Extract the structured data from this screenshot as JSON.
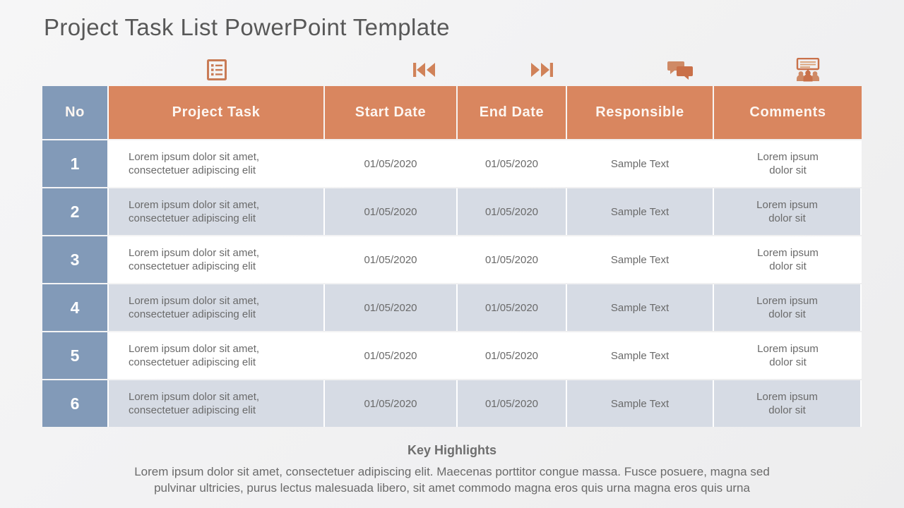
{
  "slide": {
    "title": "Project Task List PowerPoint Template",
    "background_color": "#f3f3f4",
    "accent_color": "#d9865f",
    "secondary_color": "#829ab8",
    "alt_row_color": "#d6dbe4"
  },
  "icons": [
    {
      "name": "checklist-icon",
      "label": "checklist"
    },
    {
      "name": "skip-start-icon",
      "label": "skip-to-start"
    },
    {
      "name": "skip-end-icon",
      "label": "skip-to-end"
    },
    {
      "name": "comments-icon",
      "label": "speech-bubbles"
    },
    {
      "name": "presentation-team-icon",
      "label": "presentation-with-audience"
    }
  ],
  "table": {
    "headers": {
      "no": "No",
      "task": "Project Task",
      "start_date": "Start Date",
      "end_date": "End Date",
      "responsible": "Responsible",
      "comments": "Comments"
    },
    "rows": [
      {
        "no": "1",
        "task_line1": "Lorem ipsum dolor sit amet,",
        "task_line2": "consectetuer adipiscing elit",
        "start_date": "01/05/2020",
        "end_date": "01/05/2020",
        "responsible": "Sample Text",
        "comments_line1": "Lorem ipsum",
        "comments_line2": "dolor sit"
      },
      {
        "no": "2",
        "task_line1": "Lorem ipsum dolor sit amet,",
        "task_line2": "consectetuer adipiscing elit",
        "start_date": "01/05/2020",
        "end_date": "01/05/2020",
        "responsible": "Sample Text",
        "comments_line1": "Lorem ipsum",
        "comments_line2": "dolor sit"
      },
      {
        "no": "3",
        "task_line1": "Lorem ipsum dolor sit amet,",
        "task_line2": "consectetuer adipiscing elit",
        "start_date": "01/05/2020",
        "end_date": "01/05/2020",
        "responsible": "Sample Text",
        "comments_line1": "Lorem ipsum",
        "comments_line2": "dolor sit"
      },
      {
        "no": "4",
        "task_line1": "Lorem ipsum dolor sit amet,",
        "task_line2": "consectetuer adipiscing elit",
        "start_date": "01/05/2020",
        "end_date": "01/05/2020",
        "responsible": "Sample Text",
        "comments_line1": "Lorem ipsum",
        "comments_line2": "dolor sit"
      },
      {
        "no": "5",
        "task_line1": "Lorem ipsum dolor sit amet,",
        "task_line2": "consectetuer adipiscing elit",
        "start_date": "01/05/2020",
        "end_date": "01/05/2020",
        "responsible": "Sample Text",
        "comments_line1": "Lorem ipsum",
        "comments_line2": "dolor sit"
      },
      {
        "no": "6",
        "task_line1": "Lorem ipsum dolor sit amet,",
        "task_line2": "consectetuer adipiscing elit",
        "start_date": "01/05/2020",
        "end_date": "01/05/2020",
        "responsible": "Sample Text",
        "comments_line1": "Lorem ipsum",
        "comments_line2": "dolor sit"
      }
    ]
  },
  "key_highlights": {
    "title": "Key Highlights",
    "line1": "Lorem ipsum dolor sit amet, consectetuer adipiscing elit. Maecenas porttitor congue massa. Fusce posuere, magna sed",
    "line2": "pulvinar ultricies, purus lectus malesuada libero, sit amet commodo magna eros quis urna magna eros quis urna"
  }
}
